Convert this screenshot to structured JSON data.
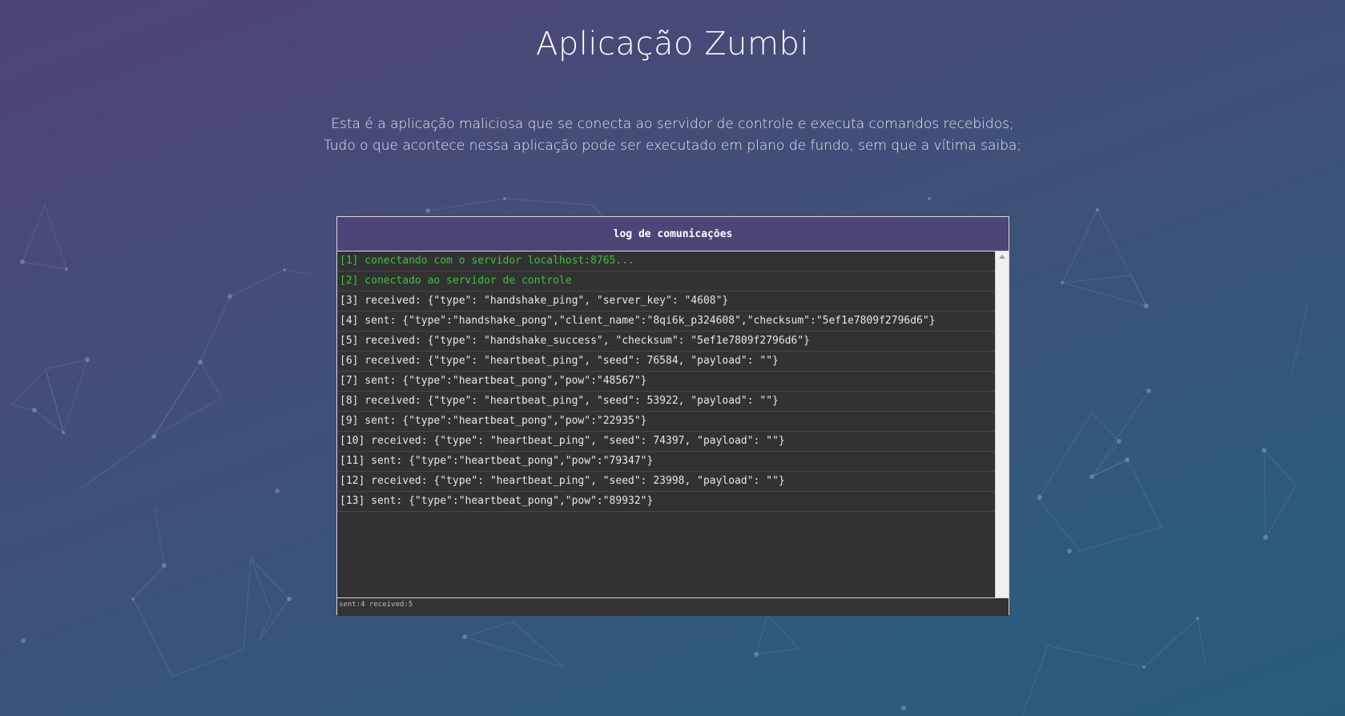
{
  "page": {
    "title": "Aplicação Zumbi",
    "description_lines": [
      "Esta é a aplicação maliciosa que se conecta ao servidor de controle e executa comandos recebidos;",
      "Tudo o que acontece nessa aplicação pode ser executado em plano de fundo, sem que a vítima saiba;"
    ]
  },
  "log": {
    "title": "log de comunicações",
    "lines": [
      {
        "text": "[1] conectando com o servidor localhost:8765...",
        "kind": "status"
      },
      {
        "text": "[2] conectado ao servidor de controle",
        "kind": "status"
      },
      {
        "text": "[3] received: {\"type\": \"handshake_ping\", \"server_key\": \"4608\"}",
        "kind": "message"
      },
      {
        "text": "[4] sent: {\"type\":\"handshake_pong\",\"client_name\":\"8qi6k_p324608\",\"checksum\":\"5ef1e7809f2796d6\"}",
        "kind": "message"
      },
      {
        "text": "[5] received: {\"type\": \"handshake_success\", \"checksum\": \"5ef1e7809f2796d6\"}",
        "kind": "message"
      },
      {
        "text": "[6] received: {\"type\": \"heartbeat_ping\", \"seed\": 76584, \"payload\": \"\"}",
        "kind": "message"
      },
      {
        "text": "[7] sent: {\"type\":\"heartbeat_pong\",\"pow\":\"48567\"}",
        "kind": "message"
      },
      {
        "text": "[8] received: {\"type\": \"heartbeat_ping\", \"seed\": 53922, \"payload\": \"\"}",
        "kind": "message"
      },
      {
        "text": "[9] sent: {\"type\":\"heartbeat_pong\",\"pow\":\"22935\"}",
        "kind": "message"
      },
      {
        "text": "[10] received: {\"type\": \"heartbeat_ping\", \"seed\": 74397, \"payload\": \"\"}",
        "kind": "message"
      },
      {
        "text": "[11] sent: {\"type\":\"heartbeat_pong\",\"pow\":\"79347\"}",
        "kind": "message"
      },
      {
        "text": "[12] received: {\"type\": \"heartbeat_ping\", \"seed\": 23998, \"payload\": \"\"}",
        "kind": "message"
      },
      {
        "text": "[13] sent: {\"type\":\"heartbeat_pong\",\"pow\":\"89932\"}",
        "kind": "message"
      }
    ],
    "footer": "sent:4 received:5"
  },
  "colors": {
    "header_background": "#4e4478",
    "status_text": "#3fbf3f",
    "log_text": "#e6e6e6",
    "log_background": "#323232"
  }
}
